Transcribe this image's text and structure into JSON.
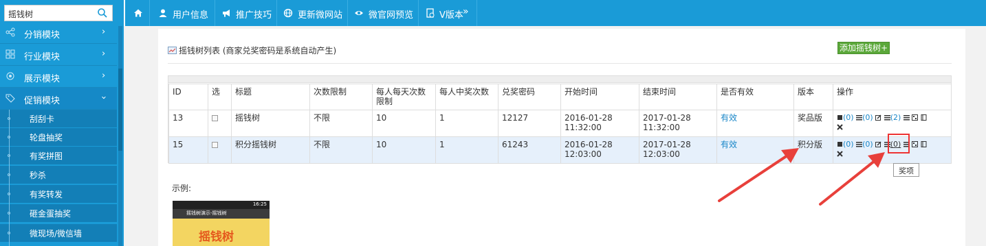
{
  "sidebar": {
    "search_value": "摇钱树",
    "modules": [
      {
        "label": "分销模块",
        "chevron": "›",
        "icon": "share-icon"
      },
      {
        "label": "行业模块",
        "chevron": "›",
        "icon": "grid-icon"
      },
      {
        "label": "展示模块",
        "chevron": "›",
        "icon": "display-icon"
      },
      {
        "label": "促销模块",
        "chevron": "›",
        "icon": "tag-icon"
      }
    ],
    "sub_items": [
      "刮刮卡",
      "轮盘抽奖",
      "有奖拼图",
      "秒杀",
      "有奖转发",
      "砸金蛋抽奖",
      "微现场/微信墙"
    ]
  },
  "topbar": {
    "items": [
      {
        "label": "",
        "icon": "home-icon"
      },
      {
        "label": "用户信息",
        "icon": "user-icon"
      },
      {
        "label": "推广技巧",
        "icon": "megaphone-icon"
      },
      {
        "label": "更新微网站",
        "icon": "globe-icon"
      },
      {
        "label": "微官网预览",
        "icon": "eye-icon"
      },
      {
        "label": "V版本",
        "icon": "version-icon",
        "suffix": "»"
      }
    ]
  },
  "main": {
    "list_title": "摇钱树列表 (商家兑奖密码是系统自动产生)",
    "add_button": "添加摇钱树+",
    "table": {
      "headers": [
        "ID",
        "选",
        "标题",
        "次数限制",
        "每人每天次数限制",
        "每人中奖次数",
        "兑奖密码",
        "开始时间",
        "结束时间",
        "是否有效",
        "版本",
        "操作"
      ],
      "rows": [
        {
          "id": "13",
          "title": "摇钱树",
          "limit": "不限",
          "daily": "10",
          "wins": "1",
          "code": "12127",
          "start": "2016-01-28 11:32:00",
          "end": "2017-01-28 11:32:00",
          "valid": "有效",
          "version": "奖品版",
          "c1": "(0)",
          "c2": "(0)",
          "c3": "(2)"
        },
        {
          "id": "15",
          "title": "积分摇钱树",
          "limit": "不限",
          "daily": "10",
          "wins": "1",
          "code": "61243",
          "start": "2016-01-28 12:03:00",
          "end": "2017-01-28 12:03:00",
          "valid": "有效",
          "version": "积分版",
          "c1": "(0)",
          "c2": "(0)",
          "c3": "(0)"
        }
      ]
    },
    "example_label": "示例:",
    "preview": {
      "time": "16:25",
      "app_title": "摇钱树演示-摇钱树",
      "logo_text": "摇钱树"
    },
    "tooltip": "奖项"
  },
  "colors": {
    "brand": "#1a9bd7",
    "add_button": "#5ba83a",
    "link": "#1a87c8",
    "annotation": "#e33333"
  }
}
